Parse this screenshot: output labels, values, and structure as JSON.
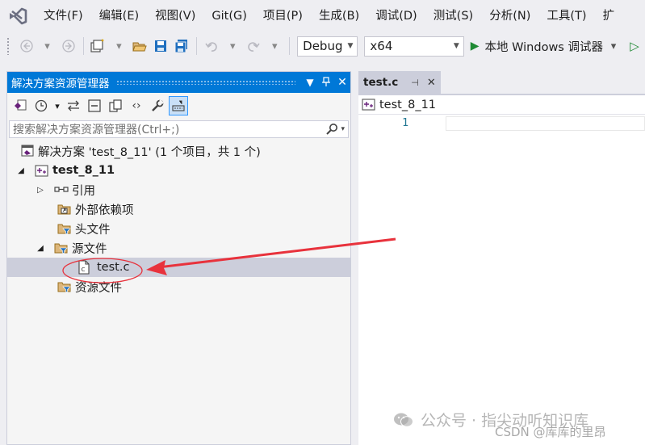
{
  "menubar": {
    "items": [
      "文件(F)",
      "编辑(E)",
      "视图(V)",
      "Git(G)",
      "项目(P)",
      "生成(B)",
      "调试(D)",
      "测试(S)",
      "分析(N)",
      "工具(T)",
      "扩"
    ]
  },
  "toolbar": {
    "configuration": "Debug",
    "platform": "x64",
    "run_label": "本地 Windows 调试器"
  },
  "solution_explorer": {
    "title": "解决方案资源管理器",
    "search_placeholder": "搜索解决方案资源管理器(Ctrl+;)",
    "tree": {
      "solution": "解决方案 'test_8_11' (1 个项目，共 1 个)",
      "project": "test_8_11",
      "references": "引用",
      "external_deps": "外部依赖项",
      "header_files": "头文件",
      "source_files": "源文件",
      "source_file_test": "test.c",
      "resource_files": "资源文件"
    }
  },
  "editor": {
    "tab_label": "test.c",
    "nav_project": "test_8_11",
    "line_number": "1"
  },
  "colors": {
    "accent": "#0078d7",
    "annotation": "#e8323c",
    "run_green": "#1e8a34",
    "project_purple": "#68217a"
  },
  "watermark": {
    "line1": "公众号 · 指尖动听知识库",
    "line2": "CSDN @库库的里昂"
  }
}
